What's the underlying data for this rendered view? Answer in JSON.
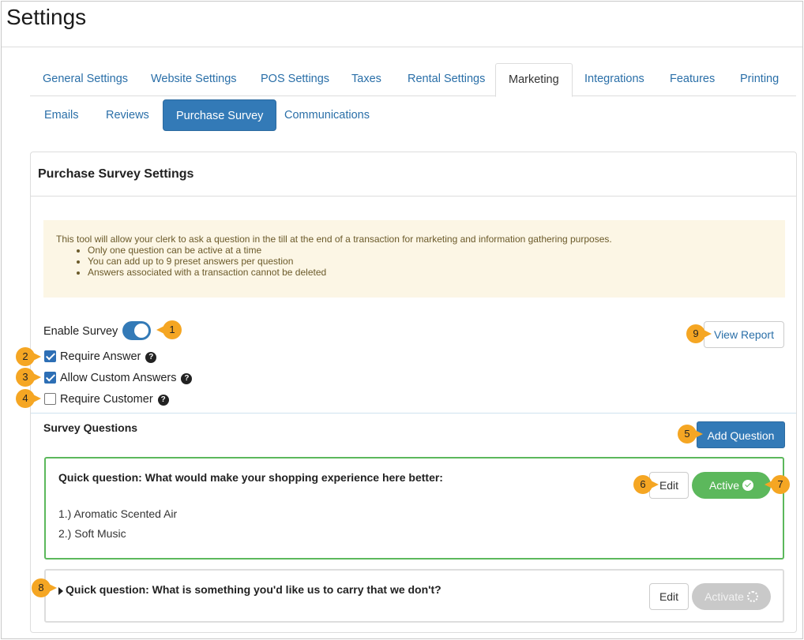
{
  "page": {
    "title": "Settings"
  },
  "tabs": [
    {
      "label": "General Settings"
    },
    {
      "label": "Website Settings"
    },
    {
      "label": "POS Settings"
    },
    {
      "label": "Taxes"
    },
    {
      "label": "Rental Settings"
    },
    {
      "label": "Marketing",
      "active": true
    },
    {
      "label": "Integrations"
    },
    {
      "label": "Features"
    },
    {
      "label": "Printing"
    }
  ],
  "subtabs": [
    {
      "label": "Emails"
    },
    {
      "label": "Reviews"
    },
    {
      "label": "Purchase Survey",
      "active": true
    },
    {
      "label": "Communications"
    }
  ],
  "panel": {
    "title": "Purchase Survey Settings",
    "info": {
      "intro": "This tool will allow your clerk to ask a question in the till at the end of a transaction for marketing and information gathering purposes.",
      "bullets": [
        "Only one question can be active at a time",
        "You can add up to 9 preset answers per question",
        "Answers associated with a transaction cannot be deleted"
      ]
    },
    "enable_survey": {
      "label": "Enable Survey",
      "on": true
    },
    "view_report": "View Report",
    "options": [
      {
        "label": "Require Answer",
        "checked": true
      },
      {
        "label": "Allow Custom Answers",
        "checked": true
      },
      {
        "label": "Require Customer",
        "checked": false
      }
    ],
    "survey_questions_title": "Survey Questions",
    "add_question": "Add Question",
    "questions": [
      {
        "text": "Quick question: What would make your shopping experience here better:",
        "answers": [
          "1.) Aromatic Scented Air",
          "2.) Soft Music"
        ],
        "edit": "Edit",
        "status": "Active"
      },
      {
        "text": "Quick question: What is something you'd like us to carry that we don't?",
        "edit": "Edit",
        "status": "Activate"
      }
    ]
  },
  "markers": [
    "1",
    "2",
    "3",
    "4",
    "5",
    "6",
    "7",
    "8",
    "9"
  ],
  "colors": {
    "primary": "#337ab7",
    "success": "#5cb85c",
    "marker": "#f5a623",
    "info_bg": "#fcf6e5"
  }
}
